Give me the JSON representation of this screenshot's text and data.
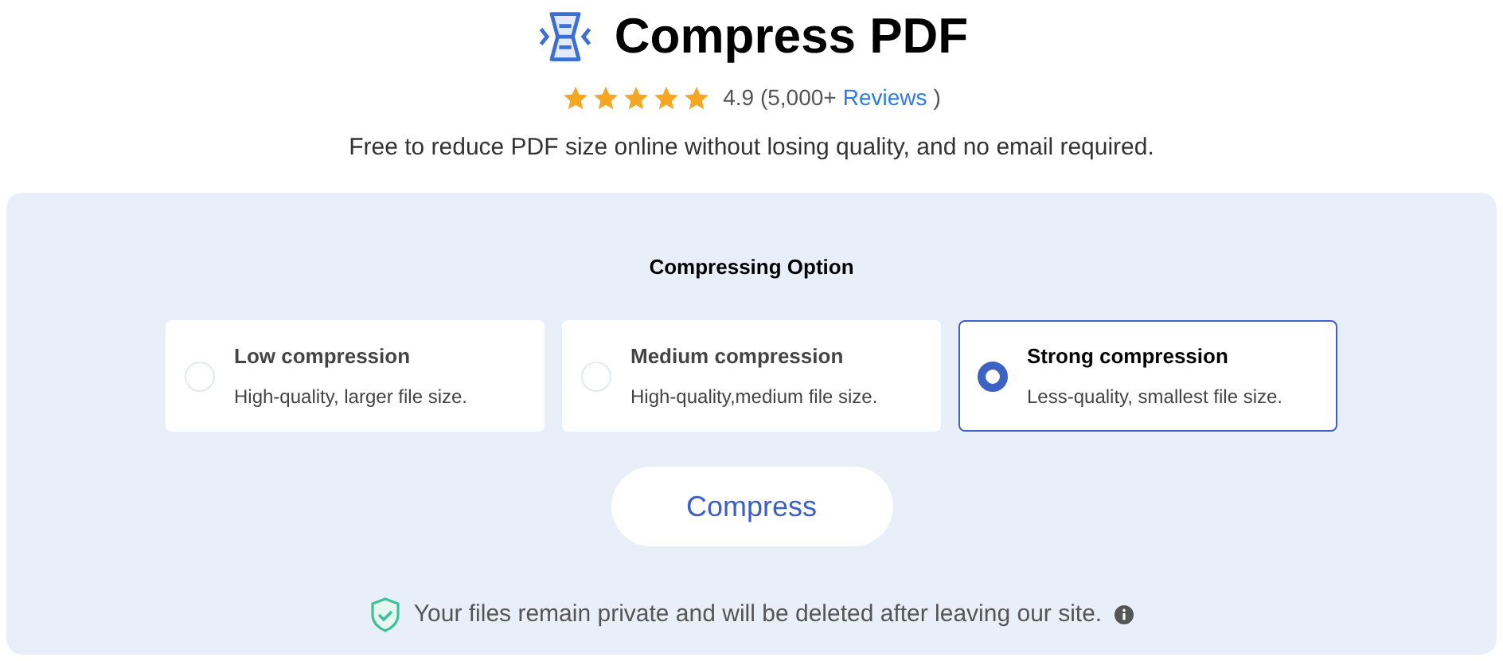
{
  "header": {
    "title": "Compress PDF",
    "stars": 5,
    "rating": "4.9 (5,000+",
    "reviews_link": "Reviews",
    "rating_close": ")",
    "subtitle": "Free to reduce PDF size online without losing quality, and no email required."
  },
  "panel": {
    "heading": "Compressing Option",
    "options": [
      {
        "title": "Low compression",
        "description": "High-quality, larger file size.",
        "selected": false
      },
      {
        "title": "Medium compression",
        "description": "High-quality,medium file size.",
        "selected": false
      },
      {
        "title": "Strong compression",
        "description": "Less-quality, smallest file size.",
        "selected": true
      }
    ],
    "button": "Compress",
    "privacy_note": "Your files remain private and will be deleted after leaving our site."
  }
}
